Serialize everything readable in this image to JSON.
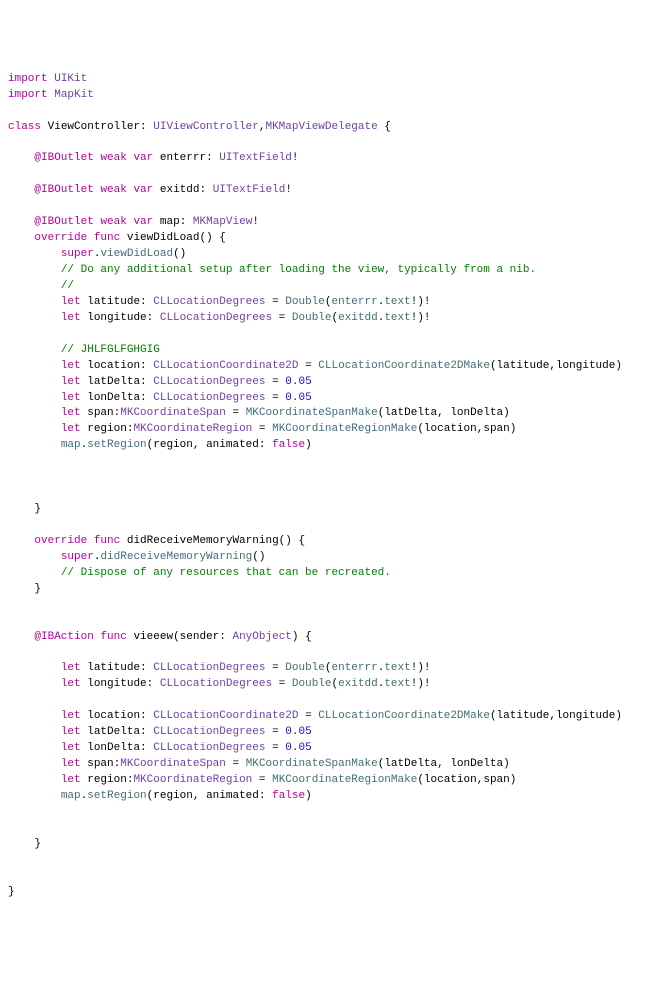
{
  "tok": {
    "import": "import",
    "class": "class",
    "weak": "weak",
    "var": "var",
    "let": "let",
    "override": "override",
    "func": "func",
    "super": "super",
    "IBOutlet": "@IBOutlet",
    "IBAction": "@IBAction",
    "UIKit": "UIKit",
    "MapKit": "MapKit",
    "ViewController": "ViewController",
    "UIViewController": "UIViewController",
    "MKMapViewDelegate": "MKMapViewDelegate",
    "UITextField": "UITextField",
    "MKMapView": "MKMapView",
    "CLLocationDegrees": "CLLocationDegrees",
    "CLLocationCoordinate2D": "CLLocationCoordinate2D",
    "MKCoordinateSpan": "MKCoordinateSpan",
    "MKCoordinateRegion": "MKCoordinateRegion",
    "AnyObject": "AnyObject",
    "enterrr": "enterrr",
    "exitdd": "exitdd",
    "map": "map",
    "viewDidLoad": "viewDidLoad",
    "didReceiveMemoryWarning": "didReceiveMemoryWarning",
    "vieeew": "vieeew",
    "sender": "sender",
    "latitude": "latitude",
    "longitude": "longitude",
    "location": "location",
    "latDelta": "latDelta",
    "lonDelta": "lonDelta",
    "span": "span",
    "region": "region",
    "text": "text",
    "setRegion": "setRegion",
    "animated": "animated",
    "Double": "Double",
    "CLLocationCoordinate2DMake": "CLLocationCoordinate2DMake",
    "MKCoordinateSpanMake": "MKCoordinateSpanMake",
    "MKCoordinateRegionMake": "MKCoordinateRegionMake",
    "num005": "0.05",
    "valFalse": "false",
    "cmt1": "// Do any additional setup after loading the view, typically from a nib.",
    "cmt2": "//",
    "cmt3": "// JHLFGLFGHGIG",
    "cmt4": "// Dispose of any resources that can be recreated."
  }
}
